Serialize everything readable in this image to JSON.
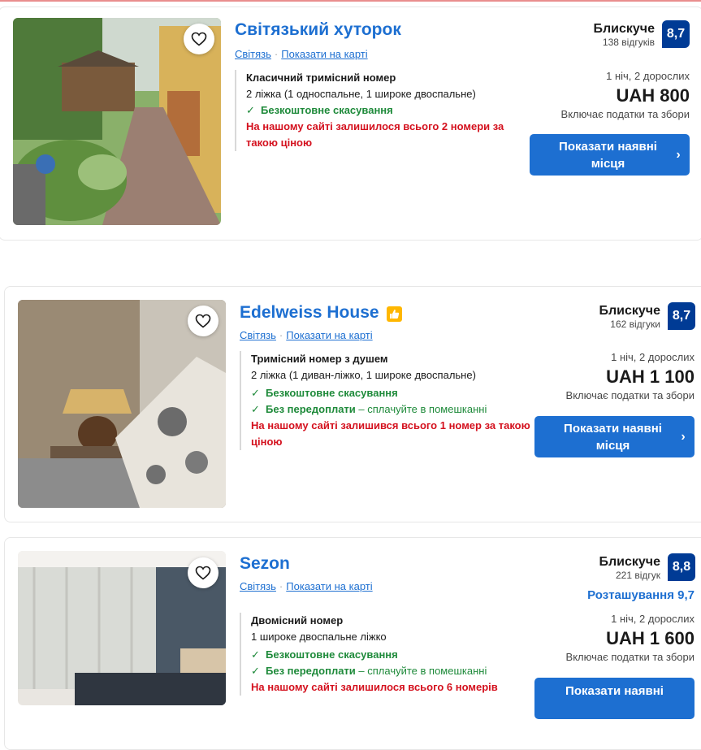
{
  "listings": [
    {
      "name": "Світязький хуторок",
      "location": "Світязь",
      "map_link": "Показати на карті",
      "rating_word": "Блискуче",
      "reviews": "138 відгуків",
      "score": "8,7",
      "room_name": "Класичний тримісний номер",
      "beds": "2 ліжка (1 односпальне, 1 широке двоспальне)",
      "free_cancel": "Безкоштовне скасування",
      "availability": "На нашому сайті залишилося всього 2 номери за такою ціною",
      "nights": "1 ніч, 2 дорослих",
      "price": "UAH 800",
      "taxes": "Включає податки та збори",
      "cta": "Показати наявні місця"
    },
    {
      "name": "Edelweiss House",
      "location": "Світязь",
      "map_link": "Показати на карті",
      "rating_word": "Блискуче",
      "reviews": "162 відгуки",
      "score": "8,7",
      "room_name": "Тримісний номер з душем",
      "beds": "2 ліжка (1 диван-ліжко, 1 широке двоспальне)",
      "free_cancel": "Безкоштовне скасування",
      "no_prepay": "Без передоплати",
      "no_prepay_note": "– сплачуйте в помешканні",
      "availability": "На нашому сайті залишився всього 1 номер за такою ціною",
      "nights": "1 ніч, 2 дорослих",
      "price": "UAH 1 100",
      "taxes": "Включає податки та збори",
      "cta": "Показати наявні місця"
    },
    {
      "name": "Sezon",
      "location": "Світязь",
      "map_link": "Показати на карті",
      "rating_word": "Блискуче",
      "reviews": "221 відгук",
      "score": "8,8",
      "location_score": "Розташування 9,7",
      "room_name": "Двомісний номер",
      "beds": "1 широке двоспальне ліжко",
      "free_cancel": "Безкоштовне скасування",
      "no_prepay": "Без передоплати",
      "no_prepay_note": "– сплачуйте в помешканні",
      "availability": "На нашому сайті залишилося всього 6 номерів",
      "nights": "1 ніч, 2 дорослих",
      "price": "UAH 1 600",
      "taxes": "Включає податки та збори",
      "cta": "Показати наявні"
    }
  ],
  "colors": {
    "link": "#1d6fd1",
    "score_badge": "#003b95",
    "green": "#1e8a3a",
    "red": "#d4111e"
  },
  "icons": {
    "favorite": "heart-outline-icon",
    "check": "check-icon",
    "chevron": "chevron-right-icon",
    "thumbs": "thumbs-up-badge-icon"
  }
}
